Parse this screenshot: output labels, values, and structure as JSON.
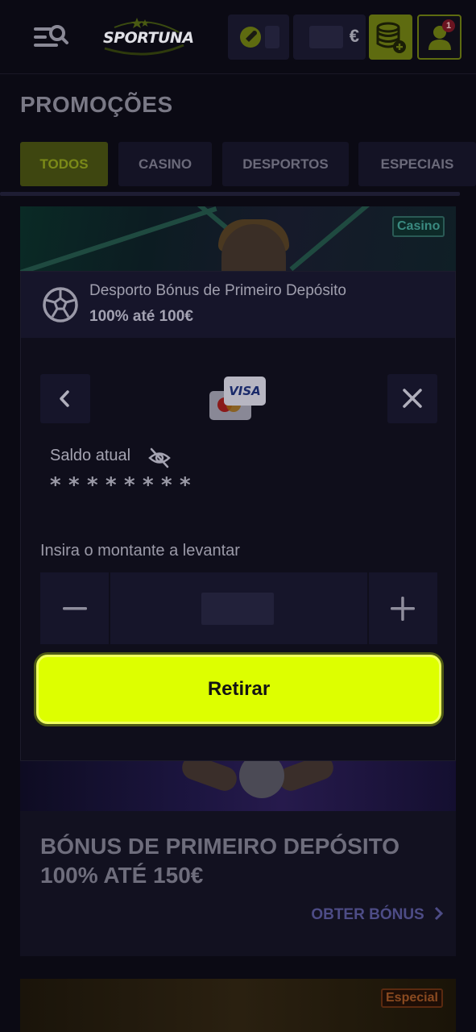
{
  "header": {
    "logo_text": "SPORTUNA",
    "currency_symbol": "€",
    "notification_count": "1",
    "accent_color": "#ddff00"
  },
  "page": {
    "title": "PROMOÇÕES",
    "tabs": [
      {
        "label": "TODOS",
        "active": true
      },
      {
        "label": "CASINO",
        "active": false
      },
      {
        "label": "DESPORTOS",
        "active": false
      },
      {
        "label": "ESPECIAIS",
        "active": false
      }
    ]
  },
  "promotions": [
    {
      "tag": "Casino"
    },
    {
      "title": "BÓNUS DE PRIMEIRO DEPÓSITO 100% ATÉ 150€",
      "cta": "OBTER BÓNUS"
    },
    {
      "tag": "Especial"
    }
  ],
  "withdraw_sheet": {
    "title": "Desporto Bónus de Primeiro Depósito",
    "subtitle": "100% até 100€",
    "payment_methods": [
      "Mastercard",
      "VISA"
    ],
    "visa_label": "VISA",
    "balance_label": "Saldo atual",
    "balance_masked": "********",
    "amount_label": "Insira o montante a levantar",
    "amount_value": "",
    "submit_label": "Retirar"
  }
}
